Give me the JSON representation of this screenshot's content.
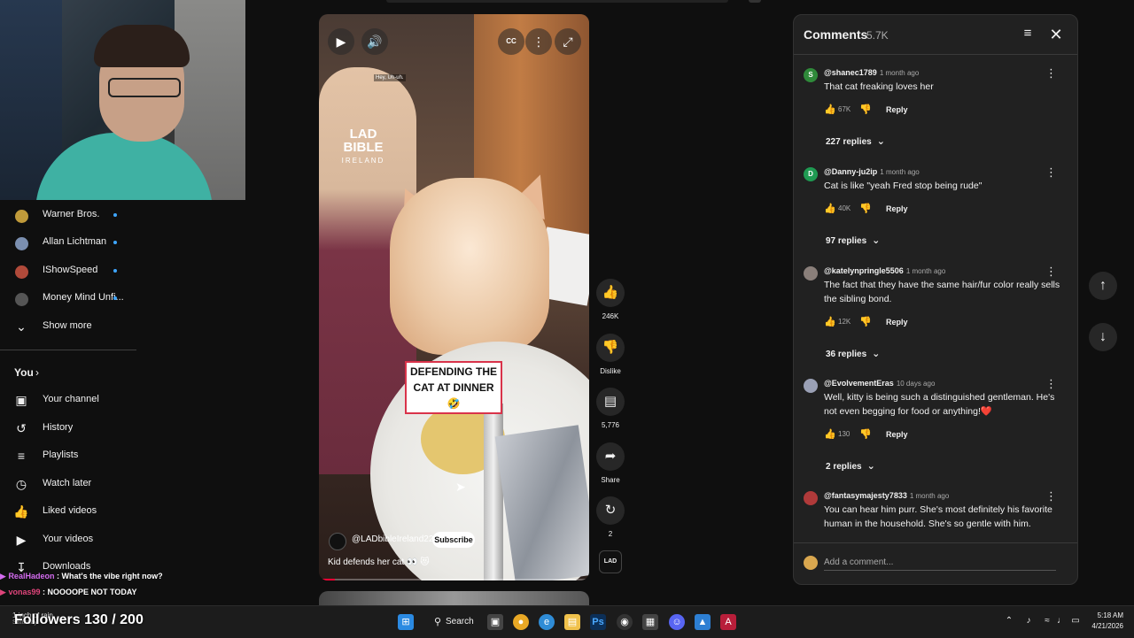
{
  "sidebar": {
    "subscriptions": [
      {
        "label": "Warner Bros.",
        "color": "#c09a3a"
      },
      {
        "label": "Allan Lichtman",
        "color": "#7b8fb0"
      },
      {
        "label": "IShowSpeed",
        "color": "#b04a3a"
      },
      {
        "label": "Money Mind Unfi...",
        "color": "#555"
      }
    ],
    "show_more": "Show more",
    "you_heading": "You",
    "you_items": [
      {
        "label": "Your channel",
        "icon": "channel-icon"
      },
      {
        "label": "History",
        "icon": "history-icon"
      },
      {
        "label": "Playlists",
        "icon": "playlists-icon"
      },
      {
        "label": "Watch later",
        "icon": "watch-later-icon"
      },
      {
        "label": "Liked videos",
        "icon": "liked-videos-icon"
      },
      {
        "label": "Your videos",
        "icon": "your-videos-icon"
      },
      {
        "label": "Downloads",
        "icon": "downloads-icon"
      }
    ]
  },
  "chat": [
    {
      "user": "RealHadeon",
      "message": "What's the vibe right now?",
      "color": "#d46cf0"
    },
    {
      "user": "vonas99",
      "message": "NOOOOPE NOT TODAY",
      "color": "#e0457b"
    }
  ],
  "followers": "Followers 130 / 200",
  "video": {
    "brand_main": "LAD\nBIBLE",
    "brand_sub": "IRELAND",
    "small_caption": "Hey, Uh-uh.",
    "caption_line1": "DEFENDING THE",
    "caption_line2": "CAT AT DINNER🤣",
    "channel": "@LADbibleIreland22",
    "subscribe": "Subscribe",
    "title": "Kid defends her cat 👀 😻",
    "progress": 0.06
  },
  "actions": {
    "likes": "246K",
    "dislike": "Dislike",
    "comments": "5,776",
    "share": "Share",
    "remix": "2"
  },
  "comments": {
    "title": "Comments",
    "count": "5.7K",
    "input_placeholder": "Add a comment...",
    "items": [
      {
        "initial": "S",
        "avatar_color": "#2f8a3a",
        "author": "@shanec1789",
        "time": "1 month ago",
        "text": "That cat freaking loves her",
        "likes": "67K",
        "replies": "227 replies"
      },
      {
        "initial": "D",
        "avatar_color": "#1f9a52",
        "author": "@Danny-ju2ip",
        "time": "1 month ago",
        "text": "Cat is like \"yeah Fred stop being rude\"",
        "likes": "40K",
        "replies": "97 replies"
      },
      {
        "initial": "",
        "avatar_color": "#8a7f7a",
        "author": "@katelynpringle5506",
        "time": "1 month ago",
        "text": "The fact that they have the same hair/fur color really sells the sibling bond.",
        "likes": "12K",
        "replies": "36 replies"
      },
      {
        "initial": "",
        "avatar_color": "#9aa0b5",
        "author": "@EvolvementEras",
        "time": "10 days ago",
        "text": "Well, kitty is being such a distinguished gentleman. He's not even begging for food or anything!❤️",
        "likes": "130",
        "replies": "2 replies"
      },
      {
        "initial": "",
        "avatar_color": "#b03a3a",
        "author": "@fantasymajesty7833",
        "time": "1 month ago",
        "text": "You can hear him purr. She's most definitely his favorite human in the household. She's so gentle with him.",
        "likes": "",
        "replies": ""
      }
    ],
    "reply_label": "Reply"
  },
  "taskbar": {
    "search": "Search",
    "weather_line1": "1 inch of rain",
    "weather_line2": "Saturday",
    "time": "5:18 AM",
    "date": "4/21/2026"
  }
}
